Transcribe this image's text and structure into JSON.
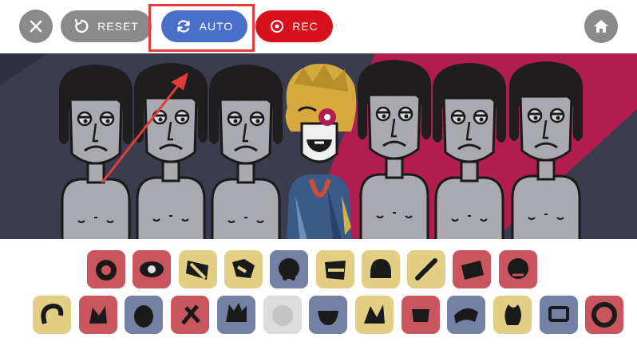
{
  "toolbar": {
    "close_icon": "close-icon",
    "reset_label": "RESET",
    "auto_label": "AUTO",
    "rec_label": "REC",
    "home_icon": "home-icon"
  },
  "colors": {
    "gray_button": "#8a8a8a",
    "auto_blue": "#4a6fc8",
    "rec_red": "#d8101c",
    "highlight_red": "#e53b3b",
    "stage_bg": "#3b3c4e",
    "stage_stripe": "#b01d4e"
  },
  "stage": {
    "characters": [
      "character-1",
      "character-2",
      "character-3",
      "character-4-active",
      "character-5",
      "character-6",
      "character-7"
    ]
  },
  "sound_icons": {
    "row1": [
      {
        "icon": "drum-icon",
        "color": "red"
      },
      {
        "icon": "eye-icon",
        "color": "red"
      },
      {
        "icon": "striped-horn-icon",
        "color": "yellow"
      },
      {
        "icon": "puzzle-hair-icon",
        "color": "yellow"
      },
      {
        "icon": "mask-icon",
        "color": "blue"
      },
      {
        "icon": "helmet-icon",
        "color": "yellow"
      },
      {
        "icon": "crown-icon",
        "color": "yellow"
      },
      {
        "icon": "bone-icon",
        "color": "yellow"
      },
      {
        "icon": "cap-icon",
        "color": "red"
      },
      {
        "icon": "face-icon",
        "color": "red"
      }
    ],
    "row2": [
      {
        "icon": "hook-icon",
        "color": "yellow"
      },
      {
        "icon": "petals-icon",
        "color": "red"
      },
      {
        "icon": "devil-icon",
        "color": "blue"
      },
      {
        "icon": "scissors-icon",
        "color": "red"
      },
      {
        "icon": "beast-icon",
        "color": "blue"
      },
      {
        "icon": "ghost-icon",
        "color": "gray"
      },
      {
        "icon": "bowl-icon",
        "color": "blue"
      },
      {
        "icon": "splash-icon",
        "color": "yellow"
      },
      {
        "icon": "mouth-icon",
        "color": "red"
      },
      {
        "icon": "wing-icon",
        "color": "blue"
      },
      {
        "icon": "flame-icon",
        "color": "yellow"
      },
      {
        "icon": "monitor-icon",
        "color": "blue"
      },
      {
        "icon": "ring-icon",
        "color": "red"
      }
    ]
  }
}
